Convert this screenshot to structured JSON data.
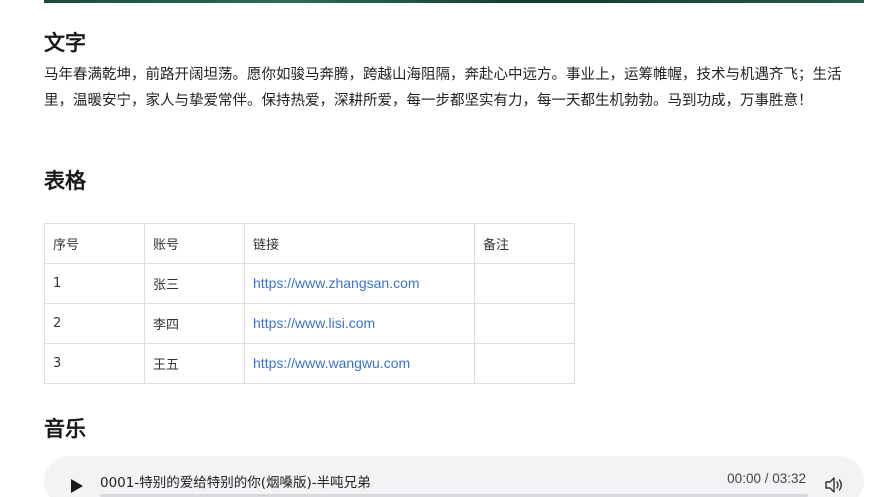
{
  "text_section": {
    "heading": "文字",
    "paragraph": "马年春满乾坤，前路开阔坦荡。愿你如骏马奔腾，跨越山海阻隔，奔赴心中远方。事业上，运筹帷幄，技术与机遇齐飞；生活里，温暖安宁，家人与挚爱常伴。保持热爱，深耕所爱，每一步都坚实有力，每一天都生机勃勃。马到功成，万事胜意！"
  },
  "table_section": {
    "heading": "表格",
    "columns": [
      "序号",
      "账号",
      "链接",
      "备注"
    ],
    "rows": [
      {
        "index": "1",
        "account": "张三",
        "link": "https://www.zhangsan.com",
        "note": ""
      },
      {
        "index": "2",
        "account": "李四",
        "link": "https://www.lisi.com",
        "note": ""
      },
      {
        "index": "3",
        "account": "王五",
        "link": "https://www.wangwu.com",
        "note": ""
      }
    ]
  },
  "music_section": {
    "heading": "音乐",
    "player": {
      "track_title": "0001-特别的爱给特别的你(烟嗓版)-半吨兄弟",
      "time_display": "00:00 / 03:32",
      "progress": 0,
      "play_icon": "play-icon",
      "volume_icon": "volume-icon",
      "background_color": "#f1f3f4"
    }
  },
  "colors": {
    "link": "#3a73c8",
    "heading": "#1a1a1a",
    "table_border": "#dcdcdc"
  }
}
